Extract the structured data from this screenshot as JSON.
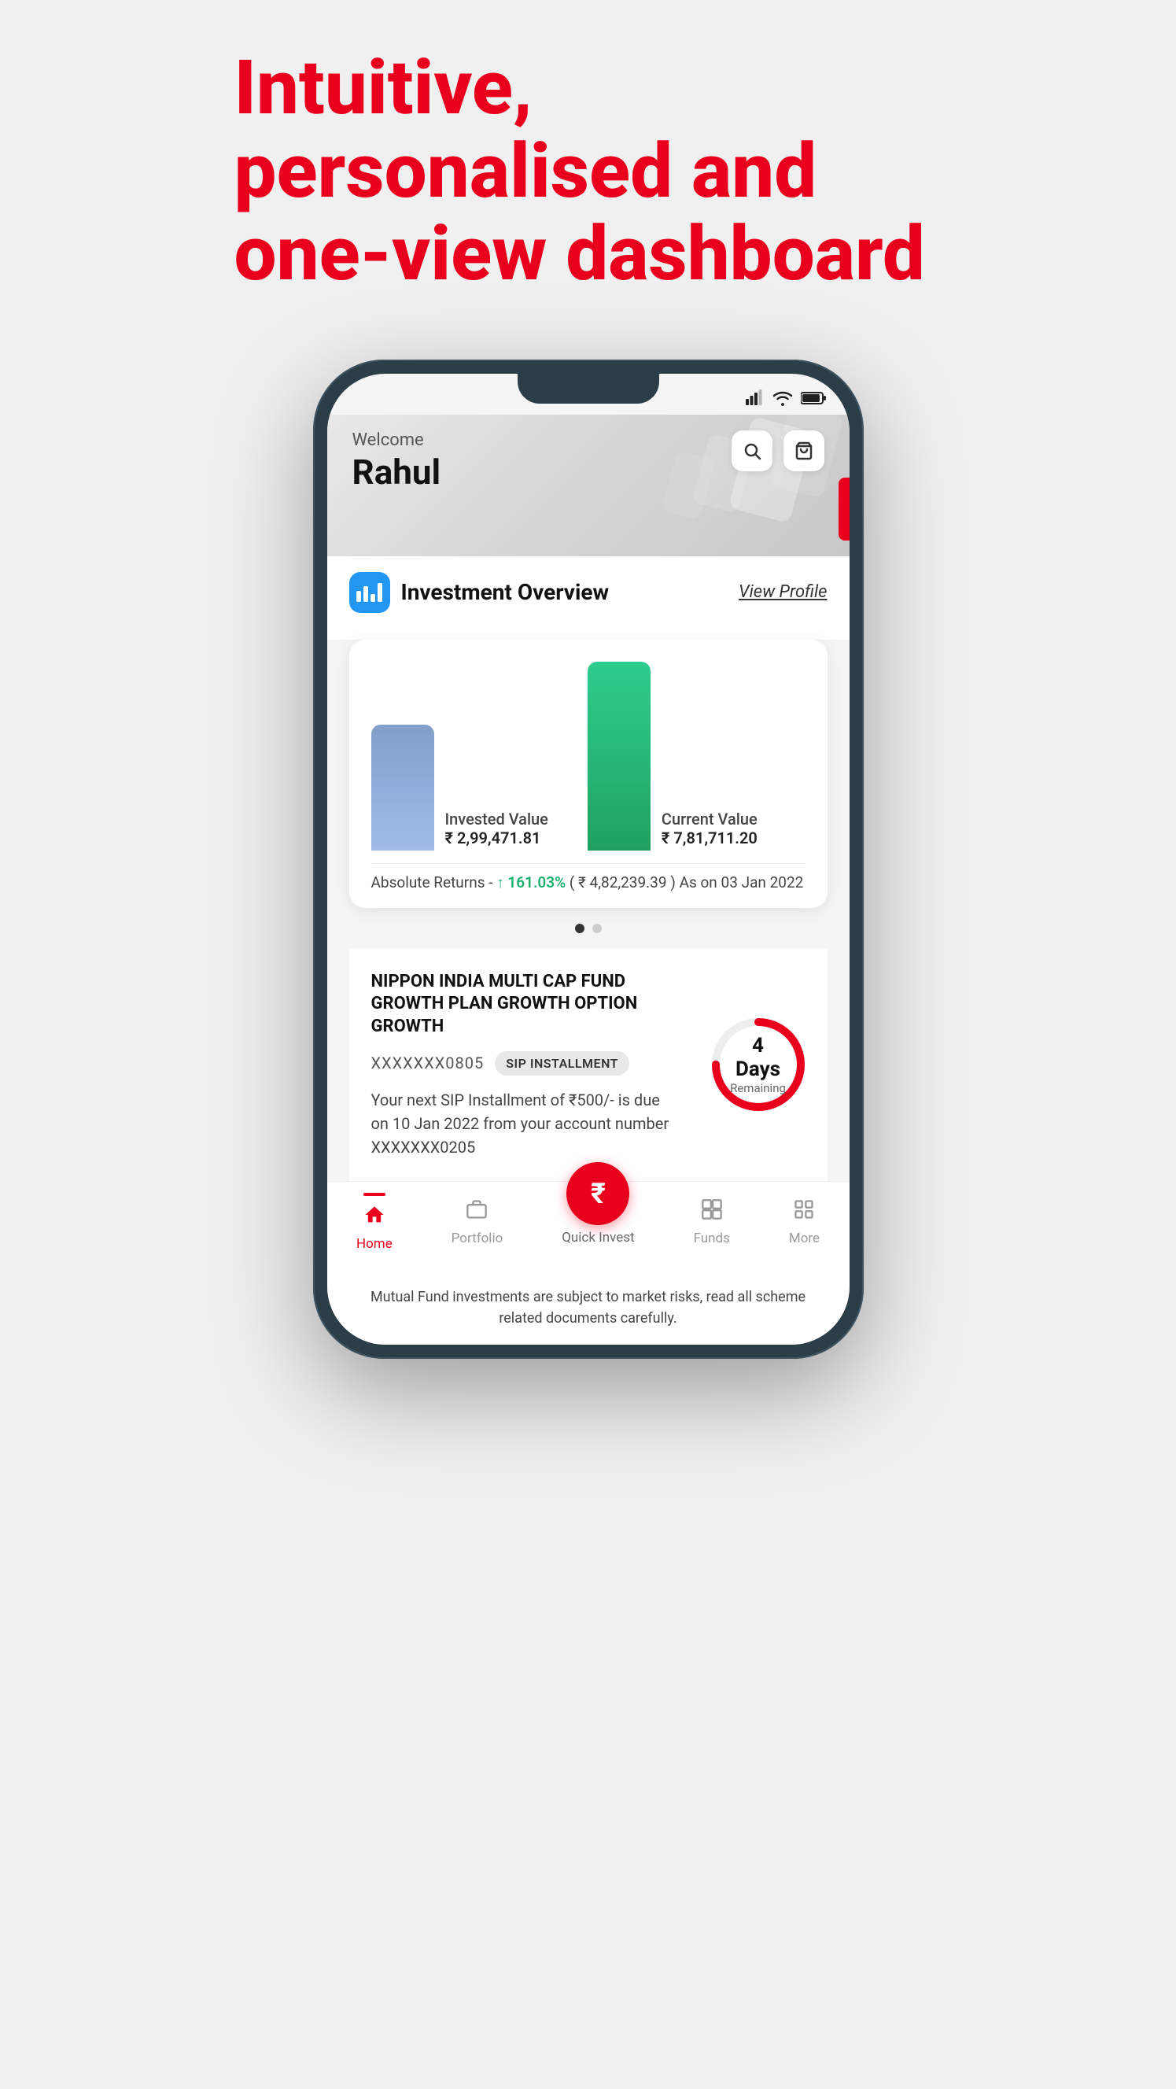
{
  "headline": {
    "line1": "Intuitive, personalised and",
    "line2": "one-view dashboard"
  },
  "statusBar": {
    "signal": "📶",
    "wifi": "wifi",
    "battery": "🔋"
  },
  "header": {
    "welcome": "Welcome",
    "userName": "Rahul",
    "searchLabel": "search",
    "cartLabel": "cart"
  },
  "overview": {
    "title": "Investment Overview",
    "viewProfile": "View Profile",
    "investedLabel": "Invested Value",
    "investedValue": "₹ 2,99,471.81",
    "currentLabel": "Current Value",
    "currentValue": "₹ 7,81,711.20",
    "returns": "Absolute Returns -",
    "returnsPercent": "↑ 161.03%",
    "returnsAmount": "( ₹ 4,82,239.39 )",
    "asOn": "As on 03 Jan 2022"
  },
  "sipCard": {
    "fundName": "NIPPON INDIA MULTI CAP FUND GROWTH PLAN GROWTH OPTION GROWTH",
    "accountNum": "XXXXXXX0805",
    "badge": "SIP INSTALLMENT",
    "description": "Your next SIP Installment of ₹500/- is due on 10 Jan 2022 from your account number XXXXXXX0205",
    "daysRemaining": "4 Days",
    "remainingLabel": "Remaining"
  },
  "bottomNav": {
    "home": "Home",
    "portfolio": "Portfolio",
    "quickInvest": "Quick Invest",
    "funds": "Funds",
    "more": "More"
  },
  "disclaimer": "Mutual Fund investments are subject to market risks, read all scheme related documents carefully."
}
